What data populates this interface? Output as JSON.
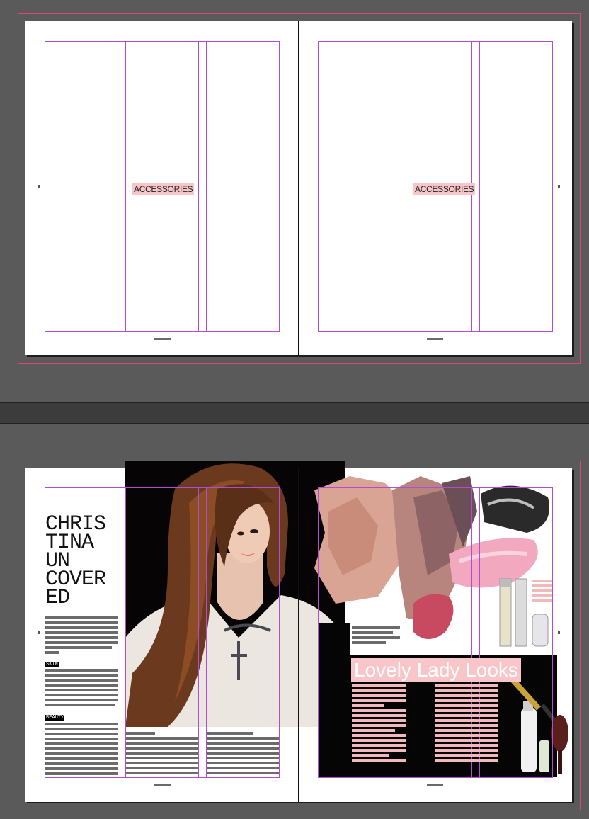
{
  "spread_top": {
    "left_page_label": "ACCESSORIES",
    "right_page_label": "ACCESSORIES"
  },
  "spread_bottom": {
    "headline_lines": [
      "CHRIS",
      "TINA",
      "UN",
      "COVER",
      "ED"
    ],
    "section_skin": "SKIN",
    "section_beauty": "BEAUTY",
    "feature_title": "Lovely Lady Looks"
  },
  "colors": {
    "pasteboard": "#5a5a5a",
    "bleed_guide": "#d9477a",
    "column_guide": "#b24bd6",
    "highlight": "#f8c6c8"
  }
}
